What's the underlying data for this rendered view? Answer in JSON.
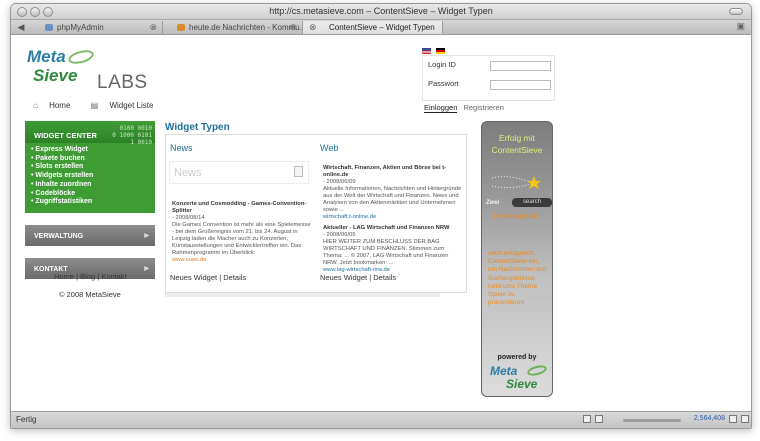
{
  "window": {
    "title": "http://cs.metasieve.com – ContentSieve – Widget Typen"
  },
  "tabs": [
    {
      "label": "phpMyAdmin",
      "active": false
    },
    {
      "label": "heute.de Nachrichten - Kommu...",
      "active": false
    },
    {
      "label": "ContentSieve – Widget Typen",
      "active": true
    }
  ],
  "logo": {
    "meta": "Meta",
    "sieve": "Sieve",
    "labs": "LABS"
  },
  "nav": {
    "home": "Home",
    "widget_list": "Widget Liste"
  },
  "sidebar": {
    "header": "WIDGET CENTER",
    "digits": [
      "0100 0010",
      "0 1000 0101",
      "1 0010"
    ],
    "items": [
      "Express Widget",
      "Pakete buchen",
      "Slots erstellen",
      "Widgets erstellen",
      "Inhalte zuordnen",
      "Codeblöcke",
      "Zugriffstatistiken"
    ],
    "sections": [
      "VERWALTUNG",
      "KONTAKT"
    ]
  },
  "footer": {
    "home": "Home",
    "blog": "Blog",
    "contact": "Kontakt",
    "sep": "|",
    "copyright": "© 2008 MetaSieve"
  },
  "main": {
    "title": "Widget Typen",
    "news": {
      "title": "News",
      "box_label": "News",
      "item_title": "Konzerte und Cosmodding - Games-Convention-Splitter",
      "item_date": "- 2008/08/14",
      "item_body": "Die Games Convention ist mehr als eine Spielemesse - bei dem Großereignis vom 21. bis 24. August in Leipzig laden die Macher auch zu Konzerten, Kunstausstellungen und Entwicklertreffen ein. Das Rahmenprogramm im Überblick:",
      "item_link": "www.sueo.de",
      "footer_new": "Neues Widget",
      "footer_details": "Details"
    },
    "web": {
      "title": "Web",
      "item1_title": "Wirtschaft, Finanzen, Aktien und Börse bei t-online.de",
      "item1_date": "- 2008/06/09",
      "item1_body": "Aktuelle Informationen, Nachrichten und Hintergründe aus der Welt der Wirtschaft und Finanzen. News und Analysen von den Aktienmärkten und Unternehmen sowie ...",
      "item1_link": "wirtschaft.t-online.de",
      "item2_title": "Aktueller - LAG Wirtschaft und Finanzen NRW",
      "item2_date": "- 2008/06/05",
      "item2_body": "HIER WEITER ZUM BESCHLUSS DER BAG WIRTSCHAFT UND FINANZEN. Stimmen zum Thema: ... © 2007, LAG Wirtschaft und Finanzen NRW. Jetzt bookmarken: ...",
      "item2_link": "www.lag-wirtschaft-nrw.de",
      "footer_new": "Neues Widget",
      "footer_details": "Details"
    }
  },
  "login": {
    "id_label": "Login ID",
    "password_label": "Passwort",
    "id_value": "",
    "password_value": "",
    "tab_login": "Einloggen",
    "tab_register": "Registrieren"
  },
  "promo": {
    "headline": "Erfolg mit ContentSieve",
    "tag": "Zwei",
    "pill": "search",
    "sub": "Im Bestellprodukt",
    "text": "setzt erfolgreich ContentSieve ein, um Nachrichten und Suchergebnisse rund ums Thema Spiele zu präsentieren",
    "powered": "powered by",
    "meta": "Meta",
    "sieve": "Sieve"
  },
  "status": {
    "text": "Fertig",
    "counter": "2,564,408"
  },
  "colors": {
    "green": "#3f9c35",
    "blue": "#1f6f9b",
    "orange": "#e98a20"
  }
}
